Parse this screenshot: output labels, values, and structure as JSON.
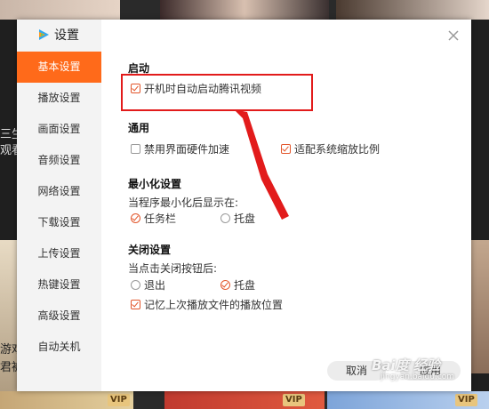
{
  "dialog": {
    "title": "设置",
    "close_icon": "close-icon",
    "app_icon": "tencent-video-logo-icon"
  },
  "nav": {
    "items": [
      "基本设置",
      "播放设置",
      "画面设置",
      "音频设置",
      "网络设置",
      "下载设置",
      "上传设置",
      "热键设置",
      "高级设置",
      "自动关机"
    ],
    "active_index": 0
  },
  "startup": {
    "title": "启动",
    "autostart": {
      "label": "开机时自动启动腾讯视频",
      "checked": true
    }
  },
  "general": {
    "title": "通用",
    "hw_accel": {
      "label": "禁用界面硬件加速",
      "checked": false
    },
    "scaling": {
      "label": "适配系统缩放比例",
      "checked": true
    }
  },
  "minimize": {
    "title": "最小化设置",
    "prompt": "当程序最小化后显示在:",
    "options": [
      {
        "label": "任务栏",
        "selected": true
      },
      {
        "label": "托盘",
        "selected": false
      }
    ]
  },
  "close": {
    "title": "关闭设置",
    "prompt": "当点击关闭按钮后:",
    "options": [
      {
        "label": "退出",
        "selected": false
      },
      {
        "label": "托盘",
        "selected": true
      }
    ],
    "remember": {
      "label": "记忆上次播放文件的播放位置",
      "checked": true
    }
  },
  "buttons": {
    "cancel": "取消",
    "apply": "应用"
  },
  "background": {
    "left_text_1": "三生",
    "left_text_2": "观看",
    "left_text_3": "游戏",
    "left_text_4": "君被",
    "vip": "VIP"
  },
  "watermark": {
    "main": "Bai度 经验",
    "sub": "jingyan.baidu.com"
  },
  "colors": {
    "accent": "#ff6a1a",
    "check": "#e2562b",
    "annotation": "#e21b1b"
  }
}
